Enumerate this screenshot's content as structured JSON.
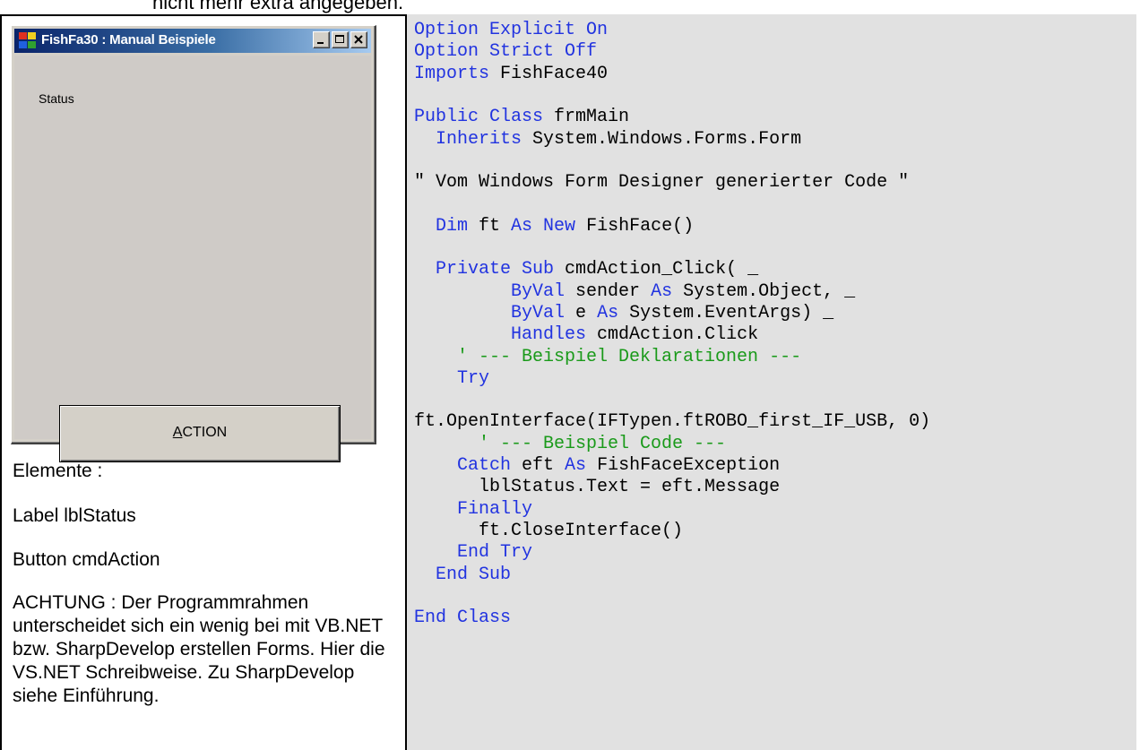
{
  "top_note": "nicht mehr extra angegeben.",
  "window": {
    "title": "FishFa30 : Manual Beispiele",
    "status_label": "Status",
    "action_label": "ACTION",
    "action_accesskey": "A"
  },
  "left": {
    "heading": "Elemente :",
    "label_item": "Label lblStatus",
    "button_item": "Button cmdAction",
    "note": "ACHTUNG : Der Programmrahmen unterscheidet sich ein wenig bei mit VB.NET bzw. SharpDevelop erstellen Forms. Hier die VS.NET Schreibweise. Zu SharpDevelop siehe Einführung."
  },
  "colors": {
    "keyword": "#2133e0",
    "comment": "#1a9a1a",
    "code_background": "#e1e1e1",
    "window_face": "#d4d0c8"
  },
  "code_lines": [
    [
      {
        "t": "Option Explicit On",
        "c": "kw"
      }
    ],
    [
      {
        "t": "Option Strict Off",
        "c": "kw"
      }
    ],
    [
      {
        "t": "Imports",
        "c": "kw"
      },
      {
        "t": " FishFace40",
        "c": ""
      }
    ],
    [],
    [
      {
        "t": "Public Class",
        "c": "kw"
      },
      {
        "t": " frmMain",
        "c": ""
      }
    ],
    [
      {
        "t": "  ",
        "c": ""
      },
      {
        "t": "Inherits",
        "c": "kw"
      },
      {
        "t": " System.Windows.Forms.Form",
        "c": ""
      }
    ],
    [],
    [
      {
        "t": "\" Vom Windows Form Designer generierter Code \"",
        "c": ""
      }
    ],
    [],
    [
      {
        "t": "  ",
        "c": ""
      },
      {
        "t": "Dim",
        "c": "kw"
      },
      {
        "t": " ft ",
        "c": ""
      },
      {
        "t": "As New",
        "c": "kw"
      },
      {
        "t": " FishFace()",
        "c": ""
      }
    ],
    [],
    [
      {
        "t": "  ",
        "c": ""
      },
      {
        "t": "Private Sub",
        "c": "kw"
      },
      {
        "t": " cmdAction_Click( _",
        "c": ""
      }
    ],
    [
      {
        "t": "         ",
        "c": ""
      },
      {
        "t": "ByVal",
        "c": "kw"
      },
      {
        "t": " sender ",
        "c": ""
      },
      {
        "t": "As",
        "c": "kw"
      },
      {
        "t": " System.Object, _",
        "c": ""
      }
    ],
    [
      {
        "t": "         ",
        "c": ""
      },
      {
        "t": "ByVal",
        "c": "kw"
      },
      {
        "t": " e ",
        "c": ""
      },
      {
        "t": "As",
        "c": "kw"
      },
      {
        "t": " System.EventArgs) _",
        "c": ""
      }
    ],
    [
      {
        "t": "         ",
        "c": ""
      },
      {
        "t": "Handles",
        "c": "kw"
      },
      {
        "t": " cmdAction.Click",
        "c": ""
      }
    ],
    [
      {
        "t": "    ' --- Beispiel Deklarationen ---",
        "c": "cm"
      }
    ],
    [
      {
        "t": "    ",
        "c": ""
      },
      {
        "t": "Try",
        "c": "kw"
      }
    ],
    [],
    [
      {
        "t": "ft.OpenInterface(IFTypen.ftROBO_first_IF_USB, 0)",
        "c": ""
      }
    ],
    [
      {
        "t": "      ' --- Beispiel Code ---",
        "c": "cm"
      }
    ],
    [
      {
        "t": "    ",
        "c": ""
      },
      {
        "t": "Catch",
        "c": "kw"
      },
      {
        "t": " eft ",
        "c": ""
      },
      {
        "t": "As",
        "c": "kw"
      },
      {
        "t": " FishFaceException",
        "c": ""
      }
    ],
    [
      {
        "t": "      lblStatus.Text = eft.Message",
        "c": ""
      }
    ],
    [
      {
        "t": "    ",
        "c": ""
      },
      {
        "t": "Finally",
        "c": "kw"
      }
    ],
    [
      {
        "t": "      ft.CloseInterface()",
        "c": ""
      }
    ],
    [
      {
        "t": "    ",
        "c": ""
      },
      {
        "t": "End Try",
        "c": "kw"
      }
    ],
    [
      {
        "t": "  ",
        "c": ""
      },
      {
        "t": "End Sub",
        "c": "kw"
      }
    ],
    [],
    [
      {
        "t": "End Class",
        "c": "kw"
      }
    ]
  ]
}
